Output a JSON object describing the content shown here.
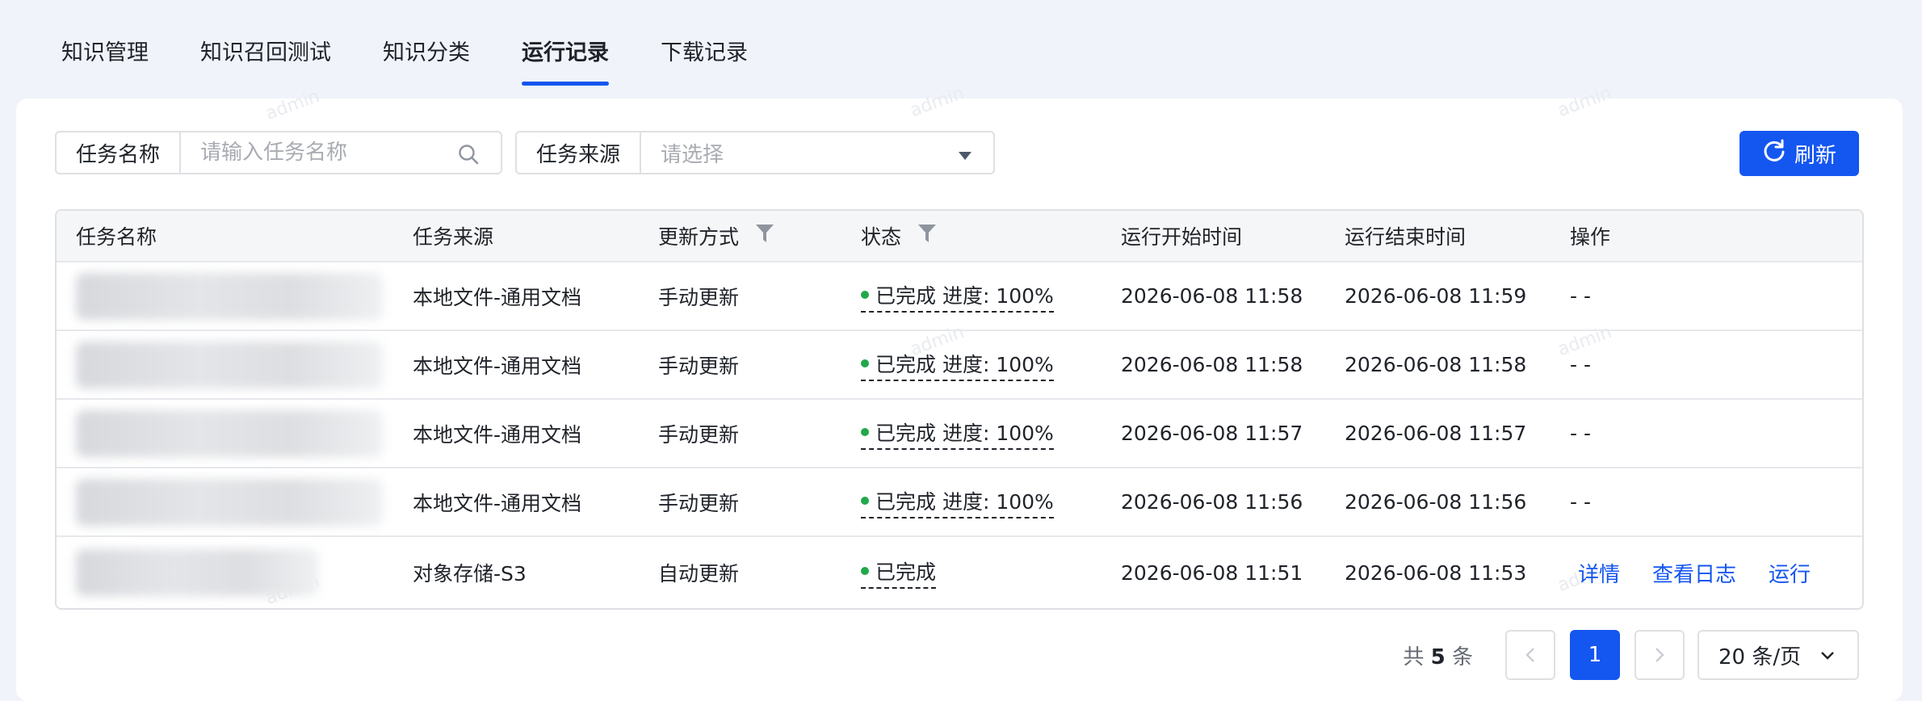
{
  "tabs": [
    {
      "label": "知识管理",
      "active": false
    },
    {
      "label": "知识召回测试",
      "active": false
    },
    {
      "label": "知识分类",
      "active": false
    },
    {
      "label": "运行记录",
      "active": true
    },
    {
      "label": "下载记录",
      "active": false
    }
  ],
  "watermark": "admin",
  "filters": {
    "task_name": {
      "label": "任务名称",
      "placeholder": "请输入任务名称"
    },
    "task_source": {
      "label": "任务来源",
      "placeholder": "请选择"
    }
  },
  "refresh_label": "刷新",
  "colors": {
    "accent": "#1456f0",
    "status_done": "#21a84a"
  },
  "table": {
    "headers": [
      "任务名称",
      "任务来源",
      "更新方式",
      "状态",
      "运行开始时间",
      "运行结束时间",
      "操作"
    ],
    "rows": [
      {
        "source": "本地文件-通用文档",
        "update": "手动更新",
        "status": "已完成",
        "progress": "进度: 100%",
        "start": "2026-06-08 11:58",
        "end": "2026-06-08 11:59",
        "ops": "- -"
      },
      {
        "source": "本地文件-通用文档",
        "update": "手动更新",
        "status": "已完成",
        "progress": "进度: 100%",
        "start": "2026-06-08 11:58",
        "end": "2026-06-08 11:58",
        "ops": "- -"
      },
      {
        "source": "本地文件-通用文档",
        "update": "手动更新",
        "status": "已完成",
        "progress": "进度: 100%",
        "start": "2026-06-08 11:57",
        "end": "2026-06-08 11:57",
        "ops": "- -"
      },
      {
        "source": "本地文件-通用文档",
        "update": "手动更新",
        "status": "已完成",
        "progress": "进度: 100%",
        "start": "2026-06-08 11:56",
        "end": "2026-06-08 11:56",
        "ops": "- -"
      },
      {
        "source": "对象存储-S3",
        "update": "自动更新",
        "status": "已完成",
        "progress": "",
        "start": "2026-06-08 11:51",
        "end": "2026-06-08 11:53",
        "actions": [
          "详情",
          "查看日志",
          "运行"
        ]
      }
    ]
  },
  "pagination": {
    "total_prefix": "共",
    "total": "5",
    "total_suffix": "条",
    "current_page": "1",
    "page_size": "20 条/页"
  }
}
